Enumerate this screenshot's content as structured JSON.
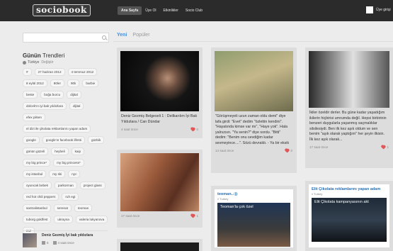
{
  "app": {
    "logo_text": "sociobook"
  },
  "nav": [
    {
      "label": "Ana Sayfa",
      "active": true
    },
    {
      "label": "Üye Ol",
      "active": false
    },
    {
      "label": "Etkinlikler",
      "active": false
    },
    {
      "label": "Socio Club",
      "active": false
    }
  ],
  "login": {
    "label": "Üye girişi"
  },
  "sidebar": {
    "search_placeholder": "",
    "trends_title_bold": "Günün",
    "trends_title_light": "Trendleri",
    "location": "Türkiye",
    "change_label": "Değiştir",
    "tags": [
      "#",
      "27 haziran 2012",
      "4 temmuz 2012",
      "8 eylül 2012",
      "80ler",
      "90lı",
      "barbie",
      "beste",
      "boğa burcu",
      "dijital",
      "dolcek'ın iyi bak yıldızlara",
      "dijital",
      "efex pilsen",
      "el dizi ile çikolata reklamlarını yapan adam",
      "google",
      "google'ın facebook ilfesti",
      "güzbik",
      "günün güzeli",
      "heybeli",
      "kaip",
      "my big prince*",
      "my big princess*",
      "my istanbul",
      "my ski",
      "nyc",
      "oyuncak bebek",
      "parkorman",
      "project glass",
      "red hot chili peppers",
      "ruh egi",
      "santralistanbul",
      "serenat",
      "teoman",
      "tuborg goldfest",
      "ukrayna",
      "valeria lukyanova",
      "zaz"
    ],
    "feature": {
      "title": "Deniz Gezmiş İyi bak yıldızlara",
      "comments": "6",
      "time": "4 saat önce"
    }
  },
  "tabs": [
    {
      "label": "Yeni",
      "active": true
    },
    {
      "label": "Popüler",
      "active": false
    }
  ],
  "cards": [
    {
      "text": "Deniz Gezmiş Belgeseli 1 : Deilkarılım İyi Bak Yıldızlara / Can Dündar",
      "time": "4 saat önce",
      "likes": "0"
    },
    {
      "text": "\"Görüşmeyeli uzun zaman oldu demi\" diye lafa girdi: \"Evet\" dedim \"özlettin kendini\". \"Hayatında kimse var mı\", \"Haye yok\". Hala yalnızsın. \"Ya senin?\" diye sordu. \"Bitti\" dedim: \"Benim onu sevdiğim kadar sevmeyince....\". Sözü devraldı. - Ya bir eksik",
      "time": "14 saat önce",
      "likes": "0"
    },
    {
      "text": "İkiler özeldir derler. Bu güne kadar yaşadığım ikilerin hiçbirisi umrumda değil. Hepsi birbirinin benzeri duygularla yaşanmış saçmalıklar silsilesiydi. Ben ilk kez aşık oldum ve sen benim \"aşık olarak yaptığım\" her şeyin ilkisin. İlk kez aşık olarak...",
      "time": "17 saat önce",
      "likes": "1"
    },
    {
      "text": "",
      "time": "17 saat önce",
      "likes": "1"
    }
  ],
  "embeds": [
    {
      "title": "teoman..:))",
      "sub": "// Turkey",
      "video_title": "Teoman'la çok özel"
    },
    {
      "title": "Elit Çikolata reklamlarını yapan adam",
      "sub": "// Turkey",
      "video_title": "Elit Çikolata kampanyasının akt"
    }
  ],
  "colors": {
    "accent": "#4a8ed8",
    "topbar": "#2b2b2b",
    "heart": "#e15656"
  }
}
